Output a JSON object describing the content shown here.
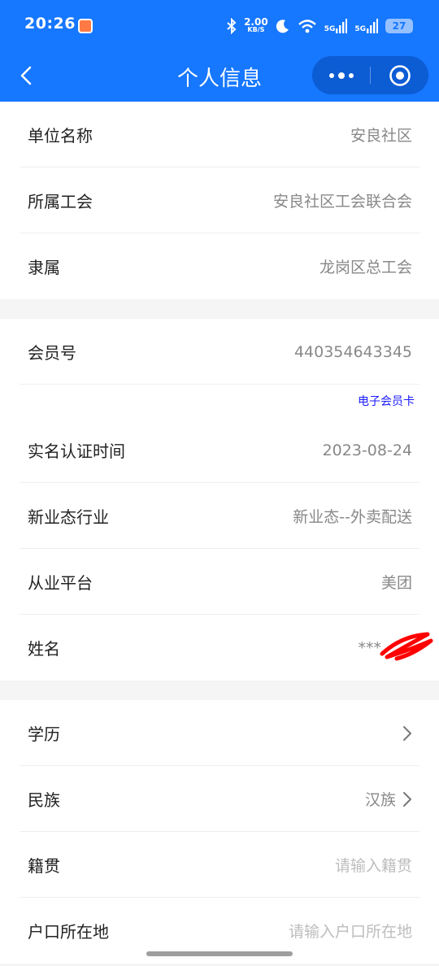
{
  "status_bar": {
    "time": "20:26",
    "net_speed": "2.00",
    "net_speed_unit": "KB/S",
    "signal1": "5G",
    "signal2": "5G",
    "battery": "27"
  },
  "header": {
    "title": "个人信息",
    "background_color": "#1677ff"
  },
  "groups": {
    "org": [
      {
        "label": "单位名称",
        "value": "安良社区"
      },
      {
        "label": "所属工会",
        "value": "安良社区工会联合会"
      },
      {
        "label": "隶属",
        "value": "龙岗区总工会"
      }
    ],
    "member": {
      "member_no": {
        "label": "会员号",
        "value": "440354643345"
      },
      "card_link": "电子会员卡",
      "verified": {
        "label": "实名认证时间",
        "value": "2023-08-24"
      },
      "industry": {
        "label": "新业态行业",
        "value": "新业态--外卖配送"
      },
      "platform": {
        "label": "从业平台",
        "value": "美团"
      },
      "name": {
        "label": "姓名",
        "value": "***"
      }
    },
    "profile": {
      "education": {
        "label": "学历",
        "value": ""
      },
      "ethnicity": {
        "label": "民族",
        "value": "汉族"
      },
      "native_place": {
        "label": "籍贯",
        "placeholder": "请输入籍贯"
      },
      "household": {
        "label": "户口所在地",
        "placeholder": "请输入户口所在地"
      }
    }
  }
}
